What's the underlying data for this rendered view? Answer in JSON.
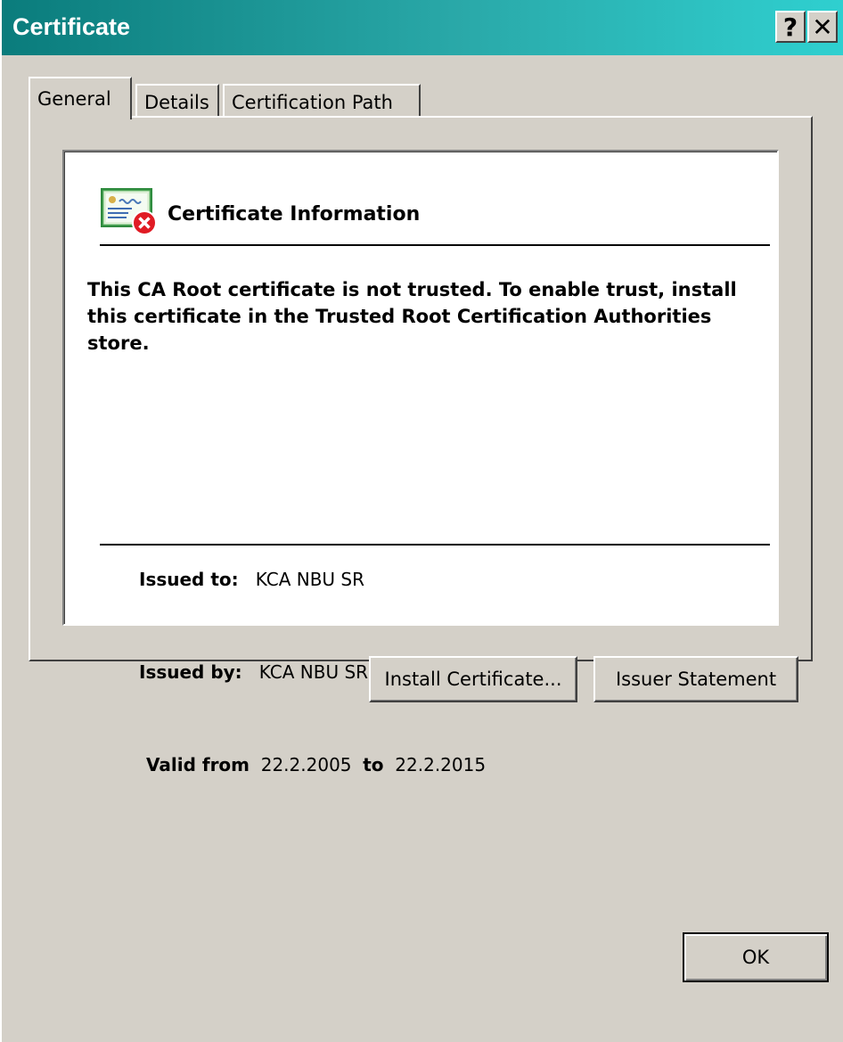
{
  "window": {
    "title": "Certificate",
    "help_label": "?",
    "close_label": "✕"
  },
  "tabs": [
    {
      "label": "General",
      "active": true
    },
    {
      "label": "Details",
      "active": false
    },
    {
      "label": "Certification Path",
      "active": false
    }
  ],
  "general": {
    "icon": "certificate-error-icon",
    "info_title": "Certificate Information",
    "warning": "This CA Root certificate is not trusted. To enable trust, install this certificate in the Trusted Root Certification Authorities store.",
    "issued_to_label": "Issued to:",
    "issued_to_value": "KCA NBU SR",
    "issued_by_label": "Issued by:",
    "issued_by_value": "KCA NBU SR",
    "valid_from_label": "Valid from",
    "valid_from_value": "22.2.2005",
    "valid_to_label": "to",
    "valid_to_value": "22.2.2015",
    "install_button": "Install Certificate...",
    "issuer_button": "Issuer Statement"
  },
  "footer": {
    "ok_button": "OK"
  },
  "colors": {
    "titlebar_start": "#0a7c7c",
    "titlebar_end": "#2fd0d0",
    "face": "#d4d0c8",
    "error_red": "#e01b24"
  }
}
